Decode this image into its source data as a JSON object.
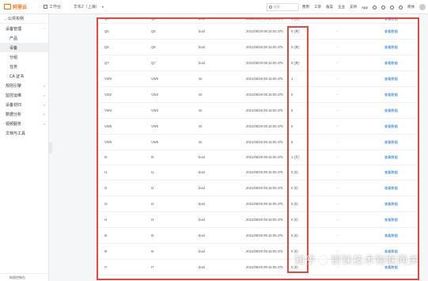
{
  "header": {
    "logo_text": "阿里云",
    "workbench": "工作台",
    "region": "华东2（上海）",
    "search_placeholder": "搜索",
    "nav": [
      "费用",
      "工单",
      "备案",
      "企业",
      "支持",
      "App"
    ],
    "lang": "简体"
  },
  "sidebar": {
    "back_label": "公共实例",
    "items": [
      {
        "label": "设备管理",
        "level": 0,
        "expanded": true
      },
      {
        "label": "产品",
        "level": 1
      },
      {
        "label": "设备",
        "level": 1,
        "active": true
      },
      {
        "label": "分组",
        "level": 1
      },
      {
        "label": "任务",
        "level": 1
      },
      {
        "label": "CA 证书",
        "level": 1
      },
      {
        "label": "规则引擎",
        "level": 0
      },
      {
        "label": "监控运维",
        "level": 0
      },
      {
        "label": "设备划归",
        "level": 0
      },
      {
        "label": "数据分析",
        "level": 0
      },
      {
        "label": "视频服务",
        "level": 0
      },
      {
        "label": "文档与工具",
        "level": 0
      }
    ],
    "footer": "新版控制台"
  },
  "table": {
    "rows": [
      {
        "c1": "Q4",
        "c2": "Q4",
        "c3": "bool",
        "c4": "2021/06/29 09:15:00.475",
        "c5": "0 (关)",
        "c6": "-",
        "c7": "查看数据"
      },
      {
        "c1": "Q5",
        "c2": "Q5",
        "c3": "bool",
        "c4": "2021/06/29 09:15:00.475",
        "c5": "0 (关)",
        "c6": "-",
        "c7": "查看数据"
      },
      {
        "c1": "Q6",
        "c2": "Q6",
        "c3": "bool",
        "c4": "2021/06/29 09:15:00.475",
        "c5": "0 (关)",
        "c6": "-",
        "c7": "查看数据"
      },
      {
        "c1": "Q7",
        "c2": "Q7",
        "c3": "bool",
        "c4": "2021/06/29 09:15:00.475",
        "c5": "0 (关)",
        "c6": "-",
        "c7": "查看数据"
      },
      {
        "c1": "VW0",
        "c2": "VW0",
        "c3": "int",
        "c4": "2021/06/29 09:15:00.475",
        "c5": "4",
        "c6": "-",
        "c7": "查看数据"
      },
      {
        "c1": "VW2",
        "c2": "VW2",
        "c3": "int",
        "c4": "2021/06/29 09:15:00.475",
        "c5": "0",
        "c6": "-",
        "c7": "查看数据"
      },
      {
        "c1": "VW4",
        "c2": "VW4",
        "c3": "int",
        "c4": "2021/06/29 09:15:00.475",
        "c5": "0",
        "c6": "-",
        "c7": "查看数据"
      },
      {
        "c1": "VW6",
        "c2": "VW6",
        "c3": "int",
        "c4": "2021/06/29 09:15:00.475",
        "c5": "0",
        "c6": "-",
        "c7": "查看数据"
      },
      {
        "c1": "VW8",
        "c2": "VW8",
        "c3": "int",
        "c4": "2021/06/29 09:15:00.475",
        "c5": "0",
        "c6": "-",
        "c7": "查看数据"
      },
      {
        "c1": "I0",
        "c2": "I0",
        "c3": "bool",
        "c4": "2021/06/29 09:15:00.475",
        "c5": "1 (开)",
        "c6": "-",
        "c7": "查看数据"
      },
      {
        "c1": "I1",
        "c2": "I1",
        "c3": "bool",
        "c4": "2021/06/29 09:15:00.475",
        "c5": "0 (0)",
        "c6": "-",
        "c7": "查看数据"
      },
      {
        "c1": "I2",
        "c2": "I2",
        "c3": "bool",
        "c4": "2021/06/29 09:15:00.475",
        "c5": "0 (0)",
        "c6": "-",
        "c7": "查看数据"
      },
      {
        "c1": "I3",
        "c2": "I3",
        "c3": "bool",
        "c4": "2021/06/29 09:15:00.475",
        "c5": "0 (0)",
        "c6": "-",
        "c7": "查看数据"
      },
      {
        "c1": "I4",
        "c2": "I4",
        "c3": "bool",
        "c4": "2021/06/29 09:15:00.475",
        "c5": "0 (0)",
        "c6": "-",
        "c7": "查看数据"
      },
      {
        "c1": "I5",
        "c2": "I5",
        "c3": "bool",
        "c4": "2021/06/29 09:15:00.475",
        "c5": "0 (0)",
        "c6": "-",
        "c7": "查看数据"
      },
      {
        "c1": "I6",
        "c2": "I6",
        "c3": "bool",
        "c4": "2021/06/29 09:15:00.475",
        "c5": "0 (0)",
        "c6": "-",
        "c7": "查看数据"
      },
      {
        "c1": "I7",
        "c2": "I7",
        "c3": "bool",
        "c4": "2021/06/29 09:15:00.475",
        "c5": "0 (0)",
        "c6": "-",
        "c7": "查看数据"
      }
    ]
  },
  "watermark": {
    "left": "知乎",
    "right": "钡铼技术物联网关"
  },
  "colors": {
    "accent": "#ff6a00",
    "link": "#0070cc",
    "highlight_border": "#e8463f"
  }
}
